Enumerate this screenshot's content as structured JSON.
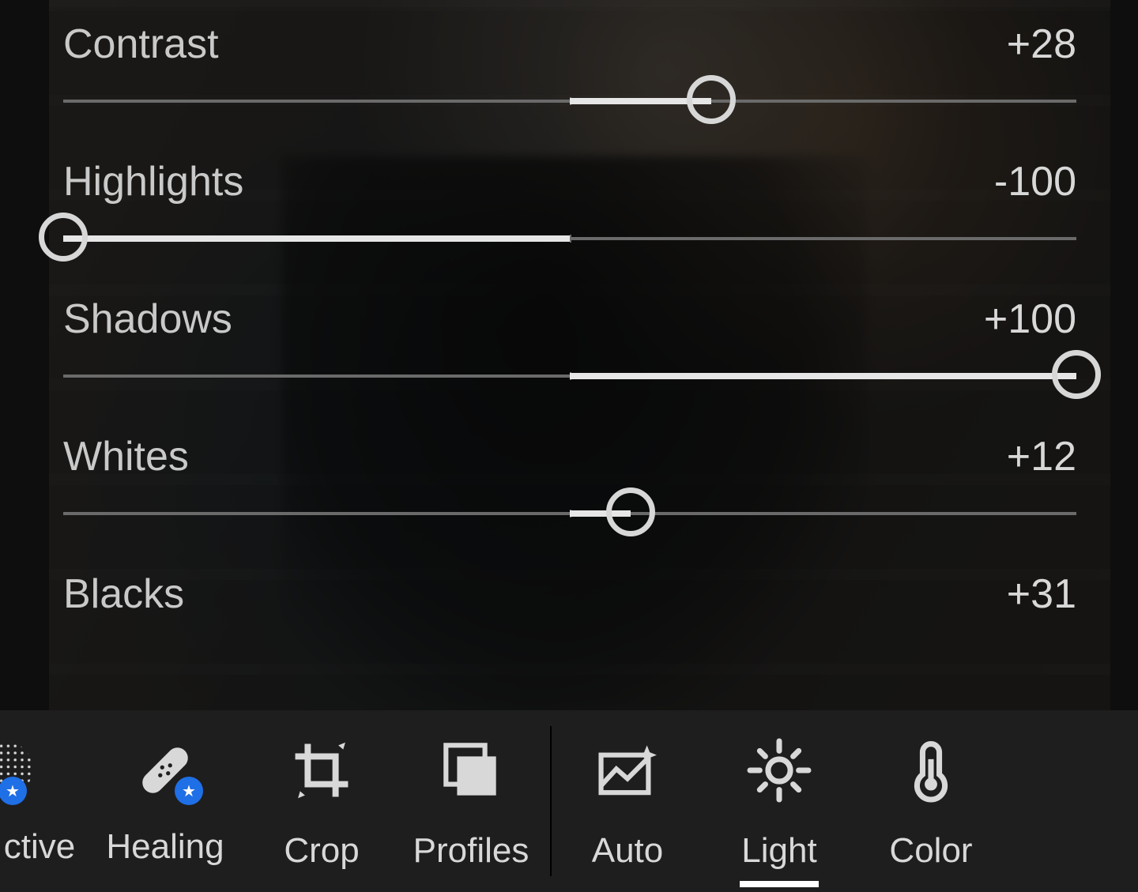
{
  "sliders": [
    {
      "label": "Contrast",
      "value": 28,
      "value_text": "+28",
      "min": -100,
      "max": 100
    },
    {
      "label": "Highlights",
      "value": -100,
      "value_text": "-100",
      "min": -100,
      "max": 100
    },
    {
      "label": "Shadows",
      "value": 100,
      "value_text": "+100",
      "min": -100,
      "max": 100
    },
    {
      "label": "Whites",
      "value": 12,
      "value_text": "+12",
      "min": -100,
      "max": 100
    },
    {
      "label": "Blacks",
      "value": 31,
      "value_text": "+31",
      "min": -100,
      "max": 100
    }
  ],
  "toolbar": {
    "selective": {
      "label": "ctive",
      "premium": true
    },
    "healing": {
      "label": "Healing",
      "premium": true
    },
    "crop": {
      "label": "Crop",
      "premium": false
    },
    "profiles": {
      "label": "Profiles",
      "premium": false
    },
    "auto": {
      "label": "Auto",
      "premium": false
    },
    "light": {
      "label": "Light",
      "premium": false,
      "active": true
    },
    "color": {
      "label": "Color",
      "premium": false
    }
  }
}
